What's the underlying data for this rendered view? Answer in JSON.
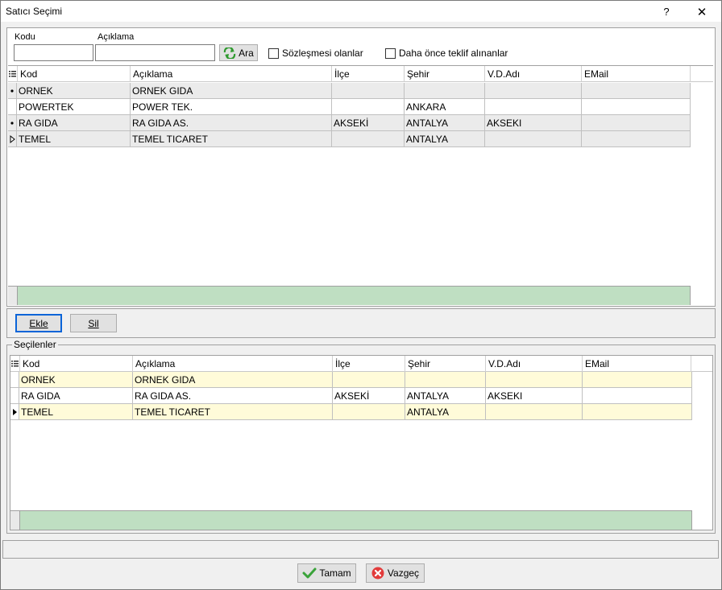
{
  "window": {
    "title": "Satıcı Seçimi",
    "help_glyph": "?",
    "close_glyph": "✕"
  },
  "search": {
    "kodu_label": "Kodu",
    "aciklama_label": "Açıklama",
    "kodu_value": "",
    "aciklama_value": "",
    "search_button": "Ara",
    "contract_checkbox": "Sözleşmesi olanlar",
    "contract_checked": false,
    "prev_offer_checkbox": "Daha önce teklif alınanlar",
    "prev_offer_checked": false
  },
  "columns": [
    "Kod",
    "Açıklama",
    "İlçe",
    "Şehir",
    "V.D.Adı",
    "EMail"
  ],
  "top_grid": {
    "rows": [
      {
        "marker": "dot",
        "cells": [
          "ORNEK",
          "ORNEK GIDA",
          "",
          "",
          "",
          ""
        ]
      },
      {
        "marker": "",
        "cells": [
          "POWERTEK",
          "POWER TEK.",
          "",
          "ANKARA",
          "",
          ""
        ]
      },
      {
        "marker": "dot",
        "cells": [
          "RA GIDA",
          "RA GIDA  AS.",
          "AKSEKİ",
          "ANTALYA",
          "AKSEKI",
          ""
        ]
      },
      {
        "marker": "arrow-outline",
        "cells": [
          "TEMEL",
          "TEMEL TICARET",
          "",
          "ANTALYA",
          "",
          ""
        ]
      }
    ]
  },
  "actions": {
    "add_button": "Ekle",
    "remove_button": "Sil"
  },
  "selected": {
    "group_label": "Seçilenler",
    "rows": [
      {
        "marker": "",
        "cells": [
          "ORNEK",
          "ORNEK GIDA",
          "",
          "",
          "",
          ""
        ]
      },
      {
        "marker": "",
        "cells": [
          "RA GIDA",
          "RA GIDA  AS.",
          "AKSEKİ",
          "ANTALYA",
          "AKSEKI",
          ""
        ]
      },
      {
        "marker": "arrow",
        "cells": [
          "TEMEL",
          "TEMEL TICARET",
          "",
          "ANTALYA",
          "",
          ""
        ]
      }
    ]
  },
  "dialog_buttons": {
    "ok": "Tamam",
    "cancel": "Vazgeç"
  },
  "colors": {
    "row_alt": "#ebebeb",
    "row_white": "#ffffff",
    "selected_row": "#fffbd9",
    "footer": "#bfdfc2",
    "focus_border": "#0a64d8"
  }
}
